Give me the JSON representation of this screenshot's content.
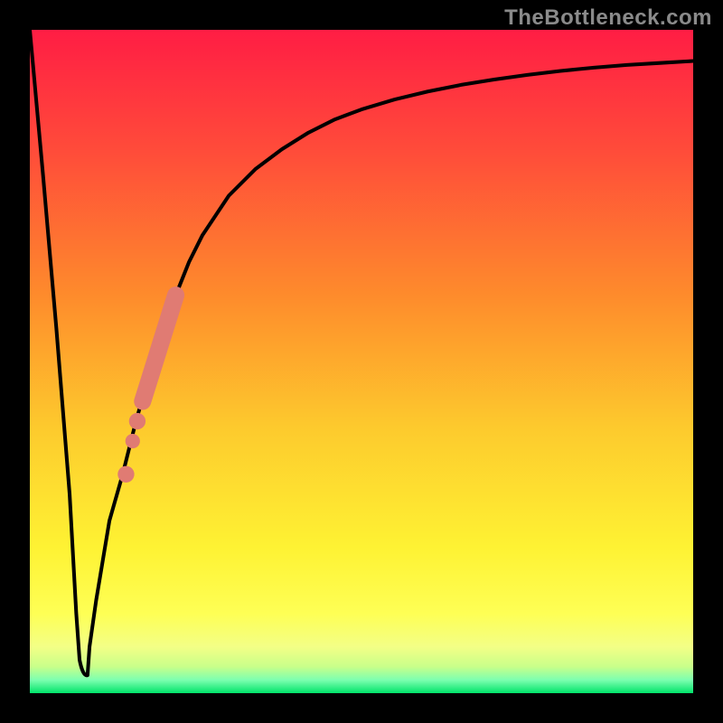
{
  "watermark": "TheBottleneck.com",
  "colors": {
    "frame": "#000000",
    "gradient_top": "#ff1d44",
    "gradient_mid1": "#fe8b2c",
    "gradient_mid2": "#fef233",
    "gradient_low": "#f6ff7a",
    "gradient_band": "#c9ff8a",
    "gradient_bottom": "#00e36a",
    "curve": "#000000",
    "marker": "#e07b73"
  },
  "chart_data": {
    "type": "line",
    "title": "",
    "xlabel": "",
    "ylabel": "",
    "xlim": [
      0,
      100
    ],
    "ylim": [
      0,
      100
    ],
    "series": [
      {
        "name": "bottleneck-curve",
        "x": [
          0,
          2,
          4,
          6,
          7,
          8,
          9,
          10,
          11,
          12,
          14,
          16,
          18,
          20,
          22,
          24,
          26,
          28,
          30,
          34,
          38,
          42,
          46,
          50,
          55,
          60,
          65,
          70,
          75,
          80,
          85,
          90,
          95,
          100
        ],
        "y": [
          100,
          78,
          55,
          30,
          12,
          3,
          3,
          7,
          14,
          20,
          31,
          40,
          48,
          55,
          60,
          65,
          69,
          72,
          75,
          79,
          82,
          84.5,
          86.5,
          88,
          89.5,
          90.7,
          91.7,
          92.5,
          93.2,
          93.8,
          94.3,
          94.7,
          95.0,
          95.3
        ]
      }
    ],
    "optimum_x": 8,
    "markers": {
      "name": "highlight-band",
      "segment": {
        "x1": 17,
        "y1": 44,
        "x2": 22,
        "y2": 60
      },
      "dots": [
        {
          "x": 16.2,
          "y": 41
        },
        {
          "x": 15.5,
          "y": 38
        },
        {
          "x": 14.5,
          "y": 33
        }
      ]
    }
  }
}
